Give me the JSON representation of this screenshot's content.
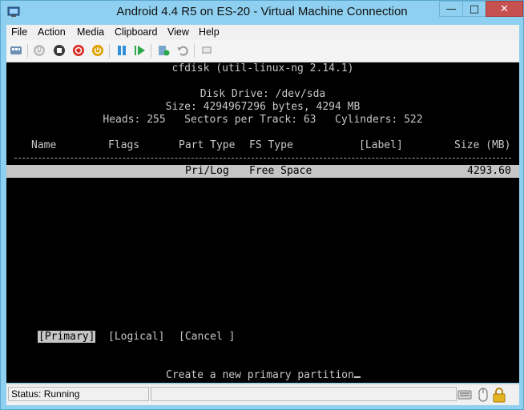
{
  "window": {
    "title": "Android 4.4 R5 on ES-20 - Virtual Machine Connection",
    "minimize_glyph": "—",
    "maximize_glyph": "□",
    "close_glyph": "✕"
  },
  "menu": [
    "File",
    "Action",
    "Media",
    "Clipboard",
    "View",
    "Help"
  ],
  "toolbar_icons": [
    "ctrl-alt-del-icon",
    "start-icon",
    "turn-off-icon",
    "shutdown-icon",
    "save-icon",
    "pause-icon",
    "resume-icon",
    "checkpoint-icon",
    "revert-icon",
    "enhanced-session-icon"
  ],
  "console": {
    "title": "cfdisk (util-linux-ng 2.14.1)",
    "disk_drive": "Disk Drive: /dev/sda",
    "size_line": "Size: 4294967296 bytes, 4294 MB",
    "geometry": "Heads: 255   Sectors per Track: 63   Cylinders: 522",
    "columns": {
      "name": "Name",
      "flags": "Flags",
      "part_type": "Part Type",
      "fs_type": "FS Type",
      "label": "[Label]",
      "size": "Size (MB)"
    },
    "row": {
      "part_type": "Pri/Log",
      "fs_type": "Free Space",
      "size": "4293.60"
    },
    "options": {
      "primary": "[Primary]",
      "logical": "[Logical]",
      "cancel": "[Cancel ]"
    },
    "prompt": "Create a new primary partition"
  },
  "status": {
    "text": "Status: Running"
  },
  "colors": {
    "titlebar": "#8fd0f0",
    "console_bg": "#000000",
    "console_fg": "#c7c7c7",
    "highlight": "#c6c6c6"
  }
}
